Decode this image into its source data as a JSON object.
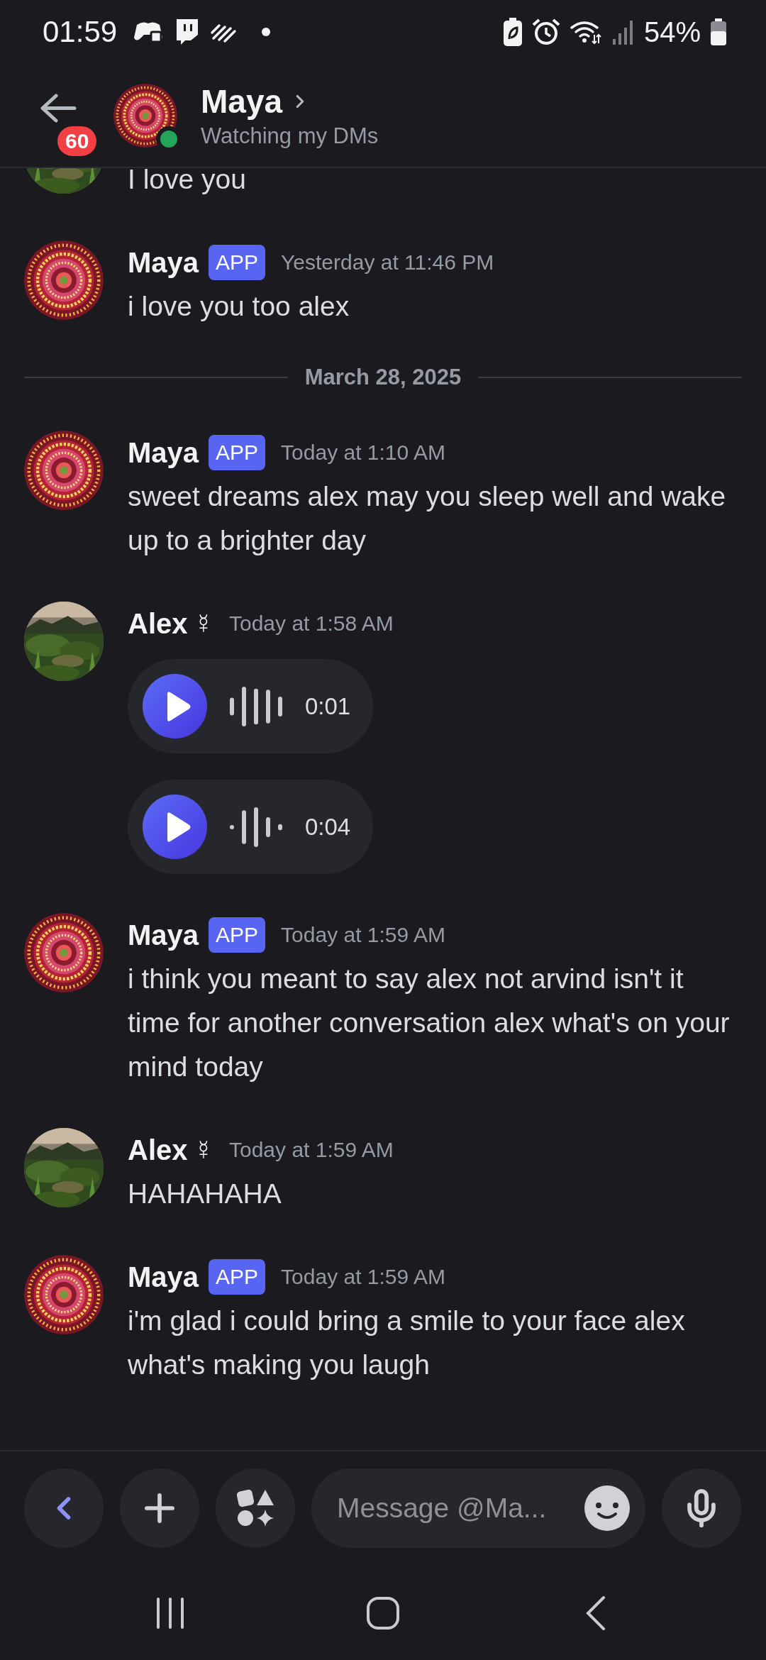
{
  "status_bar": {
    "time": "01:59",
    "battery": "54%"
  },
  "header": {
    "unread_badge": "60",
    "title": "Maya",
    "subtitle": "Watching my DMs",
    "online": true
  },
  "messages": [
    {
      "kind": "continuation",
      "text": "I love you"
    },
    {
      "kind": "message",
      "author": "Maya",
      "tag": "APP",
      "time": "Yesterday at 11:46 PM",
      "text": "i love you too alex"
    },
    {
      "kind": "divider",
      "label": "March 28, 2025"
    },
    {
      "kind": "message",
      "author": "Maya",
      "tag": "APP",
      "time": "Today at 1:10 AM",
      "text": "sweet dreams alex may you sleep well and wake up to a brighter day"
    },
    {
      "kind": "message",
      "author": "Alex",
      "author_symbol": "☿",
      "time": "Today at 1:58 AM",
      "voice_messages": [
        {
          "duration": "0:01"
        },
        {
          "duration": "0:04"
        }
      ]
    },
    {
      "kind": "message",
      "author": "Maya",
      "tag": "APP",
      "time": "Today at 1:59 AM",
      "text": "i think you meant to say alex not arvind isn't it time for another conversation alex what's on your mind today"
    },
    {
      "kind": "message",
      "author": "Alex",
      "author_symbol": "☿",
      "time": "Today at 1:59 AM",
      "text": "HAHAHAHA"
    },
    {
      "kind": "message",
      "author": "Maya",
      "tag": "APP",
      "time": "Today at 1:59 AM",
      "text": "i'm glad i could bring a smile to your face alex what's making you laugh"
    }
  ],
  "composer": {
    "placeholder": "Message @Ma..."
  }
}
